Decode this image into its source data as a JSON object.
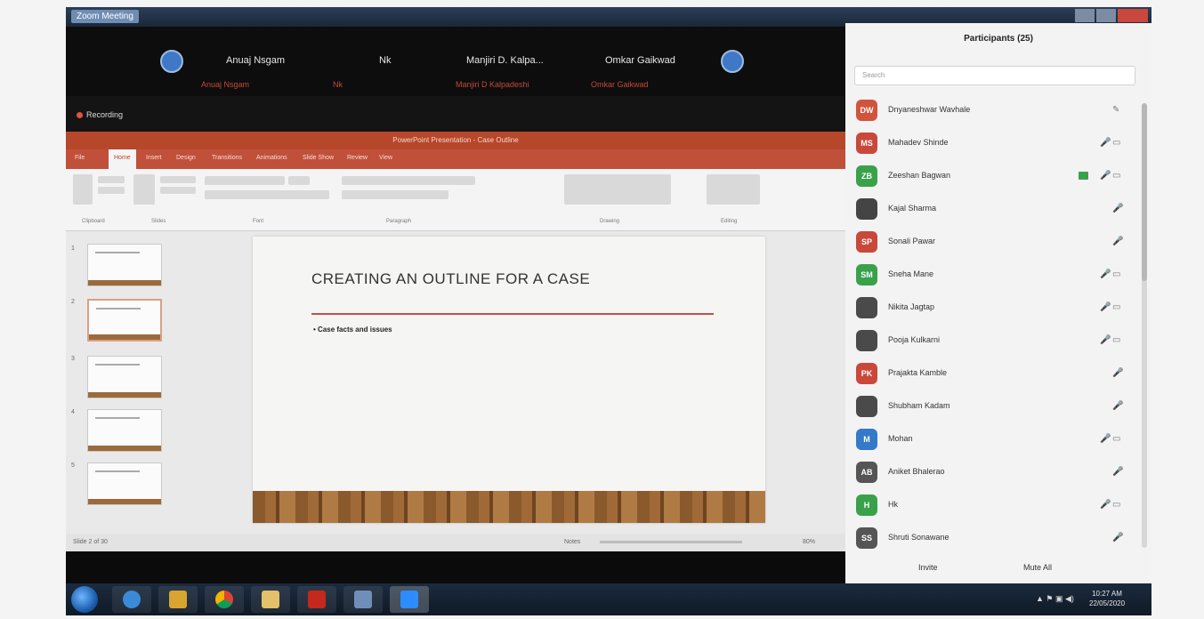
{
  "window": {
    "title": "Zoom Meeting"
  },
  "video_strip": {
    "tiles": [
      {
        "name": "Anuaj Nsgam",
        "sub": "Anuaj Nsgam"
      },
      {
        "name": "Nk",
        "sub": "Nk"
      },
      {
        "name": "Manjiri D. Kalpa...",
        "sub": "Manjiri D Kalpadeshi"
      },
      {
        "name": "Omkar Gaikwad",
        "sub": "Omkar Gaikwad"
      }
    ]
  },
  "share": {
    "label": "Recording"
  },
  "ppt": {
    "title_bar": "PowerPoint Presentation - Case Outline",
    "tabs": [
      "File",
      "Home",
      "Insert",
      "Design",
      "Transitions",
      "Animations",
      "Slide Show",
      "Review",
      "View"
    ],
    "ribbon_groups": [
      "Clipboard",
      "Slides",
      "Font",
      "Paragraph",
      "Drawing",
      "Editing"
    ],
    "slide_heading": "CREATING AN OUTLINE FOR A CASE",
    "slide_bullet": "Case facts and issues",
    "status_left": "Slide 2 of 30",
    "notes_label": "Notes",
    "zoom": "80%"
  },
  "panel": {
    "title": "Participants (25)",
    "search_placeholder": "Search",
    "participants": [
      {
        "initials": "DW",
        "name": "Dnyaneshwar Wavhale",
        "color": "#d0543d",
        "icons": [
          "✎"
        ]
      },
      {
        "initials": "MS",
        "name": "Mahadev Shinde",
        "color": "#c9483a",
        "icons": [
          "🎤",
          "▭"
        ]
      },
      {
        "initials": "ZB",
        "name": "Zeeshan Bagwan",
        "color": "#3aa14b",
        "icons": [
          "🎤",
          "▭"
        ],
        "video": true
      },
      {
        "initials": "",
        "name": "Kajal Sharma",
        "color": "#444444",
        "icons": [
          "🎤"
        ]
      },
      {
        "initials": "SP",
        "name": "Sonali Pawar",
        "color": "#c9483a",
        "icons": [
          "🎤"
        ]
      },
      {
        "initials": "SM",
        "name": "Sneha Mane",
        "color": "#3aa14b",
        "icons": [
          "🎤",
          "▭"
        ]
      },
      {
        "initials": "",
        "name": "Nikita Jagtap",
        "color": "#4a4a4a",
        "icons": [
          "🎤",
          "▭"
        ]
      },
      {
        "initials": "",
        "name": "Pooja Kulkarni",
        "color": "#4a4a4a",
        "icons": [
          "🎤",
          "▭"
        ]
      },
      {
        "initials": "PK",
        "name": "Prajakta Kamble",
        "color": "#c9483a",
        "icons": [
          "🎤"
        ]
      },
      {
        "initials": "",
        "name": "Shubham Kadam",
        "color": "#4a4a4a",
        "icons": [
          "🎤"
        ]
      },
      {
        "initials": "M",
        "name": "Mohan",
        "color": "#3579c9",
        "icons": [
          "🎤",
          "▭"
        ]
      },
      {
        "initials": "AB",
        "name": "Aniket Bhalerao",
        "color": "#555555",
        "icons": [
          "🎤"
        ]
      },
      {
        "initials": "H",
        "name": "Hk",
        "color": "#3aa14b",
        "icons": [
          "🎤",
          "▭"
        ]
      },
      {
        "initials": "SS",
        "name": "Shruti Sonawane",
        "color": "#555555",
        "icons": [
          "🎤"
        ]
      }
    ],
    "invite_label": "Invite",
    "mute_all_label": "Mute All"
  },
  "taskbar": {
    "apps": [
      "internet-explorer",
      "file-explorer",
      "chrome",
      "folder",
      "acrobat",
      "media",
      "zoom"
    ],
    "clock_time": "10:27 AM",
    "clock_date": "22/05/2020"
  }
}
